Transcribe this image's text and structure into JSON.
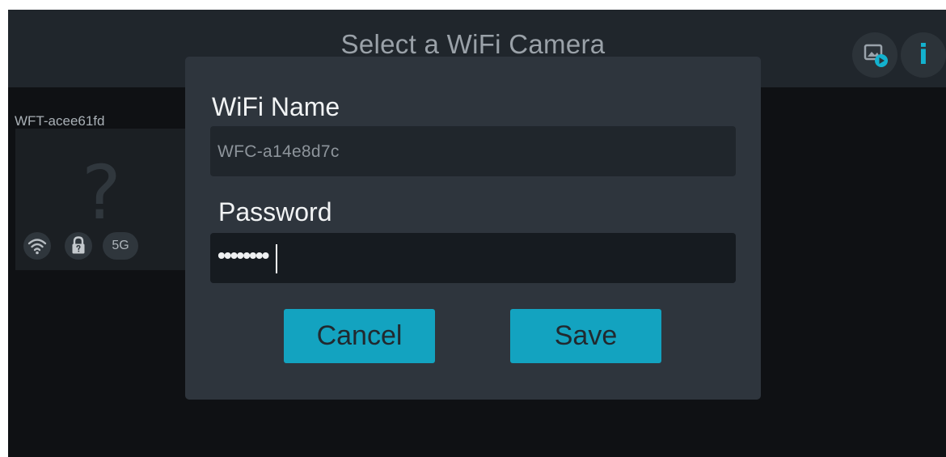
{
  "header": {
    "title": "Select a WiFi Camera",
    "icons": [
      "gallery-play-icon",
      "info-icon"
    ],
    "info_glyph": "i"
  },
  "camera_list": {
    "items": [
      {
        "name": "WFT-acee61fd",
        "placeholder_glyph": "?",
        "badges": {
          "wifi": "wifi-icon",
          "lock": "lock-icon",
          "band": "5G"
        }
      }
    ]
  },
  "dialog": {
    "wifi_name_label": "WiFi Name",
    "wifi_name_value": "WFC-a14e8d7c",
    "password_label": "Password",
    "password_masked": "••••••••",
    "cancel_label": "Cancel",
    "save_label": "Save"
  },
  "colors": {
    "accent": "#13a3c0",
    "icon_accent": "#13b2cf",
    "dialog_bg": "#2e353d",
    "screen_bg": "#0f1114",
    "topbar_bg": "#20262c"
  }
}
